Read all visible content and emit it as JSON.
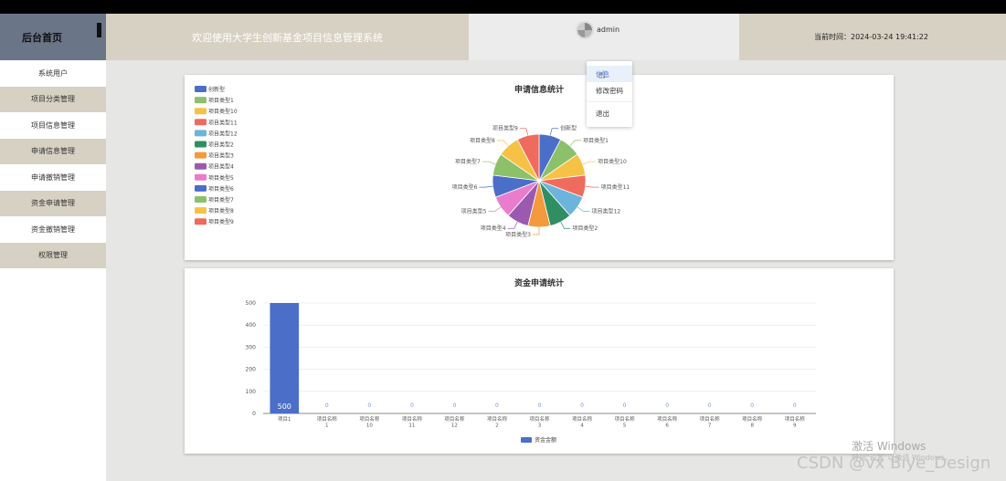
{
  "header": {
    "brand": "后台首页",
    "welcome": "欢迎使用大学生创新基金项目信息管理系统",
    "username": "admin",
    "time": "当前时间：2024-03-24 19:41:22"
  },
  "sidebar": {
    "items": [
      {
        "label": "系统用户"
      },
      {
        "label": "项目分类管理"
      },
      {
        "label": "项目信息管理"
      },
      {
        "label": "申请信息管理"
      },
      {
        "label": "申请撤销管理"
      },
      {
        "label": "资金申请管理"
      },
      {
        "label": "资金撤销管理"
      },
      {
        "label": "权限管理"
      }
    ]
  },
  "dropdown": {
    "items": [
      "信息",
      "修改密码",
      "退出"
    ]
  },
  "watermark": {
    "activate": "激活 Windows",
    "activate_sub": "转到\"设置\"以激活 Windows。",
    "csdn": "CSDN @vx Biye_Design"
  },
  "colors": {
    "palette": [
      "#4b6ec8",
      "#8cc06b",
      "#f6c246",
      "#ee6b5e",
      "#6cb4dc",
      "#2f8f62",
      "#f39a3d",
      "#9a5ab0",
      "#e97ccd"
    ]
  },
  "chart_data": [
    {
      "type": "pie",
      "title": "申请信息统计",
      "legend_position": "top-left",
      "labels": [
        "创新型",
        "项目类型1",
        "项目类型10",
        "项目类型11",
        "项目类型12",
        "项目类型2",
        "项目类型3",
        "项目类型4",
        "项目类型5",
        "项目类型6",
        "项目类型7",
        "项目类型8",
        "项目类型9"
      ],
      "values": [
        1,
        1,
        1,
        1,
        1,
        1,
        1,
        1,
        1,
        1,
        1,
        1,
        1
      ]
    },
    {
      "type": "bar",
      "title": "资金申请统计",
      "categories": [
        "项目1",
        "项目名称\n1",
        "项目名称\n10",
        "项目名称\n11",
        "项目名称\n12",
        "项目名称\n2",
        "项目名称\n3",
        "项目名称\n4",
        "项目名称\n5",
        "项目名称\n6",
        "项目名称\n7",
        "项目名称\n8",
        "项目名称\n9"
      ],
      "series": [
        {
          "name": "资金金额",
          "values": [
            500,
            0,
            0,
            0,
            0,
            0,
            0,
            0,
            0,
            0,
            0,
            0,
            0
          ]
        }
      ],
      "ylim": [
        0,
        500
      ],
      "yticks": [
        0,
        100,
        200,
        300,
        400,
        500
      ],
      "grid": true,
      "legend_position": "bottom"
    }
  ]
}
